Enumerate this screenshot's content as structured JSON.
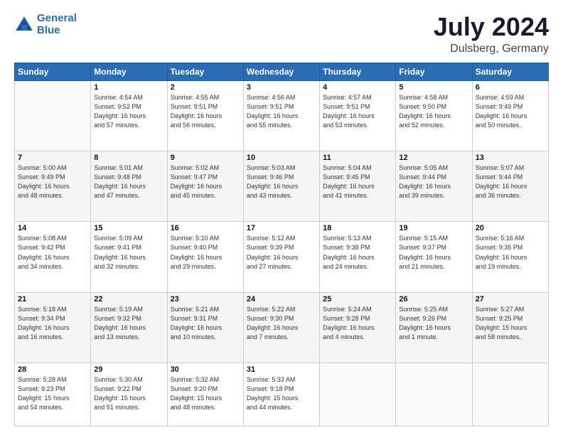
{
  "logo": {
    "line1": "General",
    "line2": "Blue"
  },
  "title": "July 2024",
  "subtitle": "Dulsberg, Germany",
  "headers": [
    "Sunday",
    "Monday",
    "Tuesday",
    "Wednesday",
    "Thursday",
    "Friday",
    "Saturday"
  ],
  "weeks": [
    [
      {
        "day": "",
        "info": ""
      },
      {
        "day": "1",
        "info": "Sunrise: 4:54 AM\nSunset: 9:52 PM\nDaylight: 16 hours\nand 57 minutes."
      },
      {
        "day": "2",
        "info": "Sunrise: 4:55 AM\nSunset: 9:51 PM\nDaylight: 16 hours\nand 56 minutes."
      },
      {
        "day": "3",
        "info": "Sunrise: 4:56 AM\nSunset: 9:51 PM\nDaylight: 16 hours\nand 55 minutes."
      },
      {
        "day": "4",
        "info": "Sunrise: 4:57 AM\nSunset: 9:51 PM\nDaylight: 16 hours\nand 53 minutes."
      },
      {
        "day": "5",
        "info": "Sunrise: 4:58 AM\nSunset: 9:50 PM\nDaylight: 16 hours\nand 52 minutes."
      },
      {
        "day": "6",
        "info": "Sunrise: 4:59 AM\nSunset: 9:49 PM\nDaylight: 16 hours\nand 50 minutes."
      }
    ],
    [
      {
        "day": "7",
        "info": "Sunrise: 5:00 AM\nSunset: 9:49 PM\nDaylight: 16 hours\nand 48 minutes."
      },
      {
        "day": "8",
        "info": "Sunrise: 5:01 AM\nSunset: 9:48 PM\nDaylight: 16 hours\nand 47 minutes."
      },
      {
        "day": "9",
        "info": "Sunrise: 5:02 AM\nSunset: 9:47 PM\nDaylight: 16 hours\nand 45 minutes."
      },
      {
        "day": "10",
        "info": "Sunrise: 5:03 AM\nSunset: 9:46 PM\nDaylight: 16 hours\nand 43 minutes."
      },
      {
        "day": "11",
        "info": "Sunrise: 5:04 AM\nSunset: 9:45 PM\nDaylight: 16 hours\nand 41 minutes."
      },
      {
        "day": "12",
        "info": "Sunrise: 5:05 AM\nSunset: 9:44 PM\nDaylight: 16 hours\nand 39 minutes."
      },
      {
        "day": "13",
        "info": "Sunrise: 5:07 AM\nSunset: 9:44 PM\nDaylight: 16 hours\nand 36 minutes."
      }
    ],
    [
      {
        "day": "14",
        "info": "Sunrise: 5:08 AM\nSunset: 9:42 PM\nDaylight: 16 hours\nand 34 minutes."
      },
      {
        "day": "15",
        "info": "Sunrise: 5:09 AM\nSunset: 9:41 PM\nDaylight: 16 hours\nand 32 minutes."
      },
      {
        "day": "16",
        "info": "Sunrise: 5:10 AM\nSunset: 9:40 PM\nDaylight: 16 hours\nand 29 minutes."
      },
      {
        "day": "17",
        "info": "Sunrise: 5:12 AM\nSunset: 9:39 PM\nDaylight: 16 hours\nand 27 minutes."
      },
      {
        "day": "18",
        "info": "Sunrise: 5:13 AM\nSunset: 9:38 PM\nDaylight: 16 hours\nand 24 minutes."
      },
      {
        "day": "19",
        "info": "Sunrise: 5:15 AM\nSunset: 9:37 PM\nDaylight: 16 hours\nand 21 minutes."
      },
      {
        "day": "20",
        "info": "Sunrise: 5:16 AM\nSunset: 9:35 PM\nDaylight: 16 hours\nand 19 minutes."
      }
    ],
    [
      {
        "day": "21",
        "info": "Sunrise: 5:18 AM\nSunset: 9:34 PM\nDaylight: 16 hours\nand 16 minutes."
      },
      {
        "day": "22",
        "info": "Sunrise: 5:19 AM\nSunset: 9:32 PM\nDaylight: 16 hours\nand 13 minutes."
      },
      {
        "day": "23",
        "info": "Sunrise: 5:21 AM\nSunset: 9:31 PM\nDaylight: 16 hours\nand 10 minutes."
      },
      {
        "day": "24",
        "info": "Sunrise: 5:22 AM\nSunset: 9:30 PM\nDaylight: 16 hours\nand 7 minutes."
      },
      {
        "day": "25",
        "info": "Sunrise: 5:24 AM\nSunset: 9:28 PM\nDaylight: 16 hours\nand 4 minutes."
      },
      {
        "day": "26",
        "info": "Sunrise: 5:25 AM\nSunset: 9:26 PM\nDaylight: 16 hours\nand 1 minute."
      },
      {
        "day": "27",
        "info": "Sunrise: 5:27 AM\nSunset: 9:25 PM\nDaylight: 15 hours\nand 58 minutes."
      }
    ],
    [
      {
        "day": "28",
        "info": "Sunrise: 5:28 AM\nSunset: 9:23 PM\nDaylight: 15 hours\nand 54 minutes."
      },
      {
        "day": "29",
        "info": "Sunrise: 5:30 AM\nSunset: 9:22 PM\nDaylight: 15 hours\nand 51 minutes."
      },
      {
        "day": "30",
        "info": "Sunrise: 5:32 AM\nSunset: 9:20 PM\nDaylight: 15 hours\nand 48 minutes."
      },
      {
        "day": "31",
        "info": "Sunrise: 5:33 AM\nSunset: 9:18 PM\nDaylight: 15 hours\nand 44 minutes."
      },
      {
        "day": "",
        "info": ""
      },
      {
        "day": "",
        "info": ""
      },
      {
        "day": "",
        "info": ""
      }
    ]
  ]
}
